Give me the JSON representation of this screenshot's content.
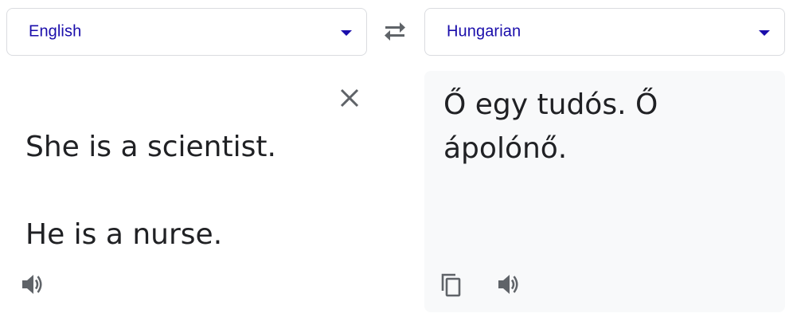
{
  "source_language": {
    "label": "English"
  },
  "target_language": {
    "label": "Hungarian"
  },
  "source": {
    "text_line1": "She is a scientist.",
    "text_line2": "He is a nurse."
  },
  "target": {
    "text_line1": "Ő egy tudós. Ő",
    "text_line2": "ápolónő."
  },
  "icons": {
    "swap": "swap-horiz-icon",
    "clear": "close-icon",
    "source_speaker": "volume-icon",
    "copy": "copy-icon",
    "target_speaker": "volume-icon",
    "dropdown": "chevron-down-icon"
  },
  "colors": {
    "language_label": "#1a0dab",
    "text": "#202124",
    "icon": "#5f6368",
    "output_background": "#f8f9fa",
    "border": "#dadce0"
  }
}
